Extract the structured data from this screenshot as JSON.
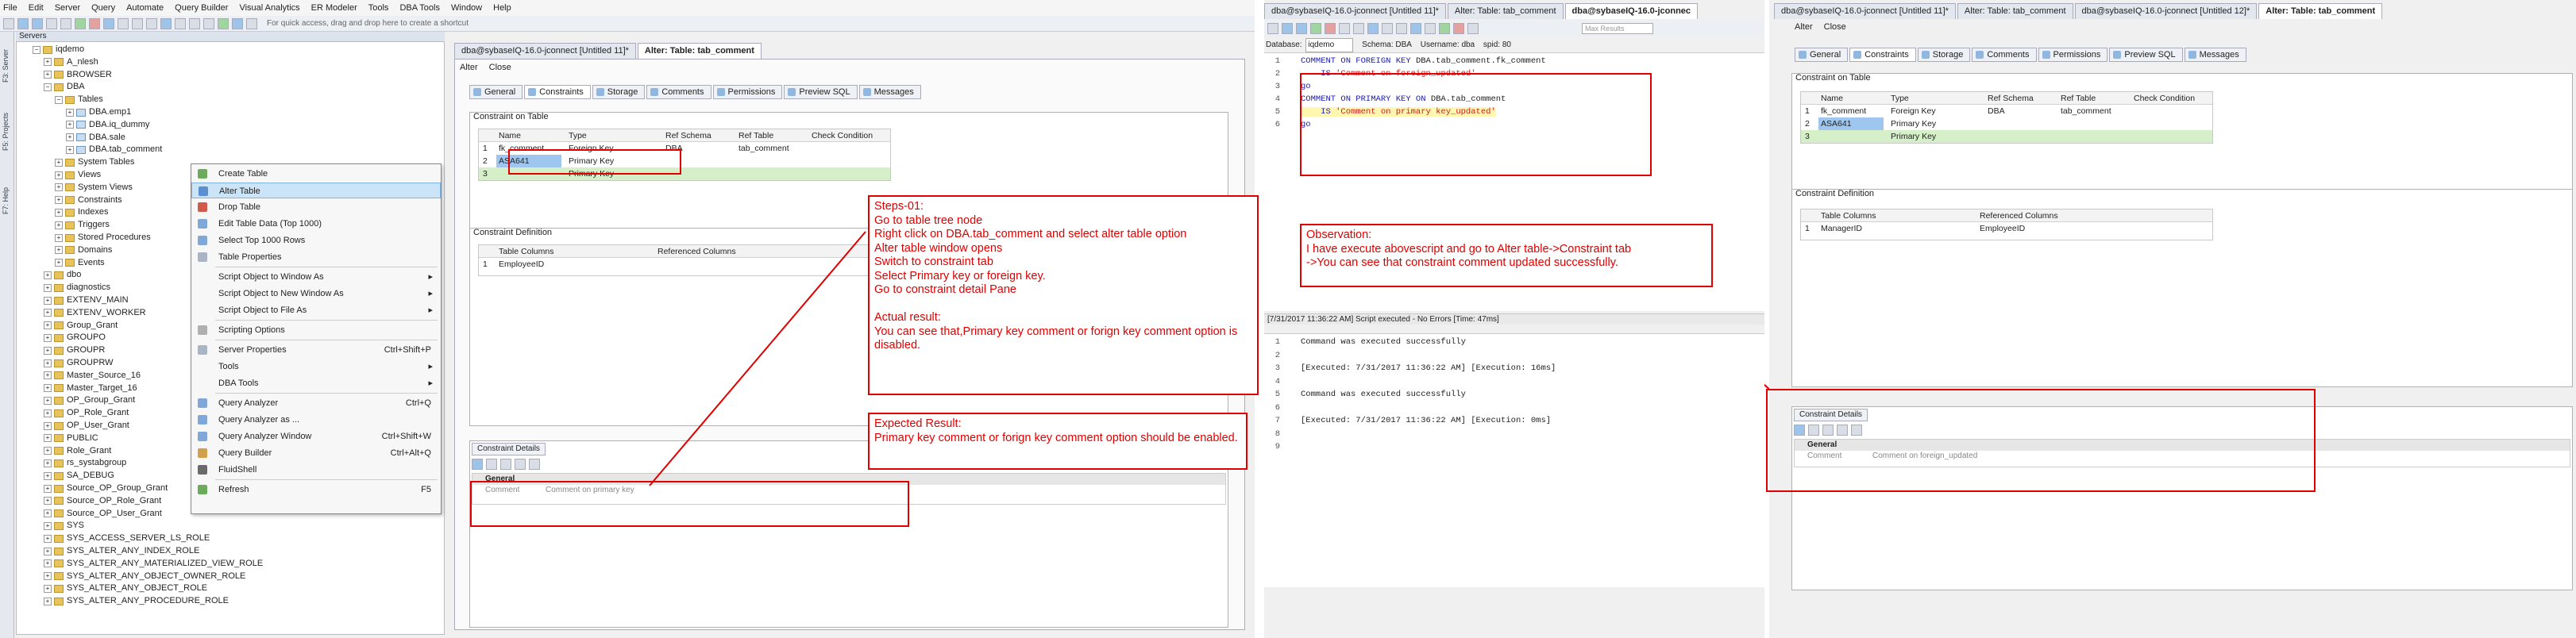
{
  "left_app": {
    "menu": [
      "File",
      "Edit",
      "Server",
      "Query",
      "Automate",
      "Query Builder",
      "Visual Analytics",
      "ER Modeler",
      "Tools",
      "DBA Tools",
      "Window",
      "Help"
    ],
    "quick_access_placeholder": "For quick access, drag and drop here to create a shortcut",
    "servers_label": "Servers",
    "sidebar_tabs": [
      "F3: Server",
      "F5: Projects",
      "F7: Help"
    ],
    "tree": [
      {
        "indent": 1,
        "label": "iqdemo",
        "kind": "folder",
        "exp": "−"
      },
      {
        "indent": 2,
        "label": "A_nlesh",
        "kind": "folder",
        "exp": "+"
      },
      {
        "indent": 2,
        "label": "BROWSER",
        "kind": "folder",
        "exp": "+"
      },
      {
        "indent": 2,
        "label": "DBA",
        "kind": "folder",
        "exp": "−"
      },
      {
        "indent": 3,
        "label": "Tables",
        "kind": "folder",
        "exp": "−"
      },
      {
        "indent": 4,
        "label": "DBA.emp1",
        "kind": "table",
        "exp": "+"
      },
      {
        "indent": 4,
        "label": "DBA.iq_dummy",
        "kind": "table",
        "exp": "+"
      },
      {
        "indent": 4,
        "label": "DBA.sale",
        "kind": "table",
        "exp": "+"
      },
      {
        "indent": 4,
        "label": "DBA.tab_comment",
        "kind": "table",
        "exp": "+"
      },
      {
        "indent": 3,
        "label": "System Tables",
        "kind": "folder",
        "exp": "+"
      },
      {
        "indent": 3,
        "label": "Views",
        "kind": "folder",
        "exp": "+"
      },
      {
        "indent": 3,
        "label": "System Views",
        "kind": "folder",
        "exp": "+"
      },
      {
        "indent": 3,
        "label": "Constraints",
        "kind": "folder",
        "exp": "+"
      },
      {
        "indent": 3,
        "label": "Indexes",
        "kind": "folder",
        "exp": "+"
      },
      {
        "indent": 3,
        "label": "Triggers",
        "kind": "folder",
        "exp": "+"
      },
      {
        "indent": 3,
        "label": "Stored Procedures",
        "kind": "folder",
        "exp": "+"
      },
      {
        "indent": 3,
        "label": "Domains",
        "kind": "folder",
        "exp": "+"
      },
      {
        "indent": 3,
        "label": "Events",
        "kind": "folder",
        "exp": "+"
      },
      {
        "indent": 2,
        "label": "dbo",
        "kind": "folder",
        "exp": "+"
      },
      {
        "indent": 2,
        "label": "diagnostics",
        "kind": "folder",
        "exp": "+"
      },
      {
        "indent": 2,
        "label": "EXTENV_MAIN",
        "kind": "folder",
        "exp": "+"
      },
      {
        "indent": 2,
        "label": "EXTENV_WORKER",
        "kind": "folder",
        "exp": "+"
      },
      {
        "indent": 2,
        "label": "Group_Grant",
        "kind": "folder",
        "exp": "+"
      },
      {
        "indent": 2,
        "label": "GROUPO",
        "kind": "folder",
        "exp": "+"
      },
      {
        "indent": 2,
        "label": "GROUPR",
        "kind": "folder",
        "exp": "+"
      },
      {
        "indent": 2,
        "label": "GROUPRW",
        "kind": "folder",
        "exp": "+"
      },
      {
        "indent": 2,
        "label": "Master_Source_16",
        "kind": "folder",
        "exp": "+"
      },
      {
        "indent": 2,
        "label": "Master_Target_16",
        "kind": "folder",
        "exp": "+"
      },
      {
        "indent": 2,
        "label": "OP_Group_Grant",
        "kind": "folder",
        "exp": "+"
      },
      {
        "indent": 2,
        "label": "OP_Role_Grant",
        "kind": "folder",
        "exp": "+"
      },
      {
        "indent": 2,
        "label": "OP_User_Grant",
        "kind": "folder",
        "exp": "+"
      },
      {
        "indent": 2,
        "label": "PUBLIC",
        "kind": "folder",
        "exp": "+"
      },
      {
        "indent": 2,
        "label": "Role_Grant",
        "kind": "folder",
        "exp": "+"
      },
      {
        "indent": 2,
        "label": "rs_systabgroup",
        "kind": "folder",
        "exp": "+"
      },
      {
        "indent": 2,
        "label": "SA_DEBUG",
        "kind": "folder",
        "exp": "+"
      },
      {
        "indent": 2,
        "label": "Source_OP_Group_Grant",
        "kind": "folder",
        "exp": "+"
      },
      {
        "indent": 2,
        "label": "Source_OP_Role_Grant",
        "kind": "folder",
        "exp": "+"
      },
      {
        "indent": 2,
        "label": "Source_OP_User_Grant",
        "kind": "folder",
        "exp": "+"
      },
      {
        "indent": 2,
        "label": "SYS",
        "kind": "folder",
        "exp": "+"
      },
      {
        "indent": 2,
        "label": "SYS_ACCESS_SERVER_LS_ROLE",
        "kind": "folder",
        "exp": "+"
      },
      {
        "indent": 2,
        "label": "SYS_ALTER_ANY_INDEX_ROLE",
        "kind": "folder",
        "exp": "+"
      },
      {
        "indent": 2,
        "label": "SYS_ALTER_ANY_MATERIALIZED_VIEW_ROLE",
        "kind": "folder",
        "exp": "+"
      },
      {
        "indent": 2,
        "label": "SYS_ALTER_ANY_OBJECT_OWNER_ROLE",
        "kind": "folder",
        "exp": "+"
      },
      {
        "indent": 2,
        "label": "SYS_ALTER_ANY_OBJECT_ROLE",
        "kind": "folder",
        "exp": "+"
      },
      {
        "indent": 2,
        "label": "SYS_ALTER_ANY_PROCEDURE_ROLE",
        "kind": "folder",
        "exp": "+"
      }
    ],
    "context_menu": [
      {
        "label": "Create Table",
        "shortcut": "",
        "arrow": false,
        "sel": false,
        "icon": "#6cab5c"
      },
      {
        "label": "Alter Table",
        "shortcut": "",
        "arrow": false,
        "sel": true,
        "icon": "#5b8fcf"
      },
      {
        "label": "Drop Table",
        "shortcut": "",
        "arrow": false,
        "sel": false,
        "icon": "#d25a4a"
      },
      {
        "label": "Edit Table Data (Top 1000)",
        "shortcut": "",
        "arrow": false,
        "sel": false,
        "icon": "#7fa8d8"
      },
      {
        "label": "Select Top 1000 Rows",
        "shortcut": "",
        "arrow": false,
        "sel": false,
        "icon": "#7fa8d8"
      },
      {
        "label": "Table Properties",
        "shortcut": "",
        "arrow": false,
        "sel": false,
        "icon": "#a9b4c4"
      },
      {
        "label": "Script Object to Window As",
        "shortcut": "",
        "arrow": true,
        "sel": false,
        "icon": ""
      },
      {
        "label": "Script Object to New Window As",
        "shortcut": "",
        "arrow": true,
        "sel": false,
        "icon": ""
      },
      {
        "label": "Script Object to File As",
        "shortcut": "",
        "arrow": true,
        "sel": false,
        "icon": ""
      },
      {
        "label": "Scripting Options",
        "shortcut": "",
        "arrow": false,
        "sel": false,
        "icon": "#b0b0b0"
      },
      {
        "label": "Server Properties",
        "shortcut": "Ctrl+Shift+P",
        "arrow": false,
        "sel": false,
        "icon": "#a9b4c4"
      },
      {
        "label": "Tools",
        "shortcut": "",
        "arrow": true,
        "sel": false,
        "icon": ""
      },
      {
        "label": "DBA Tools",
        "shortcut": "",
        "arrow": true,
        "sel": false,
        "icon": ""
      },
      {
        "label": "Query Analyzer",
        "shortcut": "Ctrl+Q",
        "arrow": false,
        "sel": false,
        "icon": "#7fa8d8"
      },
      {
        "label": "Query Analyzer as ...",
        "shortcut": "",
        "arrow": false,
        "sel": false,
        "icon": "#7fa8d8"
      },
      {
        "label": "Query Analyzer Window",
        "shortcut": "Ctrl+Shift+W",
        "arrow": false,
        "sel": false,
        "icon": "#7fa8d8"
      },
      {
        "label": "Query Builder",
        "shortcut": "Ctrl+Alt+Q",
        "arrow": false,
        "sel": false,
        "icon": "#d2a04a"
      },
      {
        "label": "FluidShell",
        "shortcut": "",
        "arrow": false,
        "sel": false,
        "icon": "#6a6a6a"
      },
      {
        "label": "Refresh",
        "shortcut": "F5",
        "arrow": false,
        "sel": false,
        "icon": "#6cab5c"
      }
    ],
    "editor_tabs": [
      {
        "label": "dba@sybaseIQ-16.0-jconnect [Untitled 11]*",
        "active": false
      },
      {
        "label": "Alter: Table: tab_comment",
        "active": true
      }
    ],
    "alter_buttons": [
      "Alter",
      "Close"
    ],
    "sub_tabs": [
      "General",
      "Constraints",
      "Storage",
      "Comments",
      "Permissions",
      "Preview SQL",
      "Messages"
    ],
    "constraint_group": "Constraint on Table",
    "constraint_headers": [
      "Name",
      "Type",
      "Ref Schema",
      "Ref Table",
      "Check Condition"
    ],
    "constraint_rows": [
      {
        "n": "1",
        "name": "fk_comment",
        "type": "Foreign Key",
        "schema": "DBA",
        "table": "tab_comment",
        "check": ""
      },
      {
        "n": "2",
        "name": "ASA641",
        "type": "Primary Key",
        "schema": "",
        "table": "",
        "check": ""
      },
      {
        "n": "3",
        "name": "",
        "type": "Primary Key",
        "schema": "",
        "table": "",
        "check": ""
      }
    ],
    "definition_group": "Constraint Definition",
    "definition_headers": [
      "Table Columns",
      "Referenced Columns"
    ],
    "definition_rows": [
      {
        "n": "1",
        "col": "EmployeeID",
        "ref": ""
      }
    ],
    "details_label": "Constraint Details",
    "details_section": "General",
    "details_key": "Comment",
    "details_value": "Comment on primary key"
  },
  "notes": {
    "steps": "Steps-01:\nGo to table tree node\nRight click on DBA.tab_comment  and select alter table option\nAlter table window opens\nSwitch to constraint tab\nSelect Primary key or foreign key.\nGo to constraint detail Pane\n\nActual result:\nYou can see that,Primary key comment or forign key comment option is disabled.",
    "expected": "Expected Result:\nPrimary key comment or forign key comment option should be enabled.",
    "observation": "Observation:\nI have execute abovescript and go to Alter table->Constraint tab\n->You can see that constraint comment updated successfully."
  },
  "middle_app": {
    "tabs": [
      {
        "label": "dba@sybaseIQ-16.0-jconnect [Untitled 11]*",
        "active": false
      },
      {
        "label": "Alter: Table: tab_comment",
        "active": false
      },
      {
        "label": "dba@sybaseIQ-16.0-jconnec",
        "active": true
      }
    ],
    "database_label": "Database:",
    "database_value": "iqdemo",
    "schema_label": "Schema:",
    "schema_value": "DBA",
    "username_label": "Username:",
    "username_value": "dba",
    "spid_label": "spid:",
    "spid_value": "80",
    "max_results_placeholder": "Max Results",
    "code": [
      {
        "n": "1",
        "parts": [
          {
            "t": "COMMENT ON FOREIGN KEY ",
            "c": "kw"
          },
          {
            "t": "DBA.tab_comment.fk_comment",
            "c": ""
          }
        ]
      },
      {
        "n": "2",
        "parts": [
          {
            "t": "    IS ",
            "c": "kw"
          },
          {
            "t": "'Comment on foreign_updated'",
            "c": "str"
          }
        ]
      },
      {
        "n": "3",
        "parts": [
          {
            "t": "go",
            "c": "kw"
          }
        ]
      },
      {
        "n": "4",
        "parts": [
          {
            "t": "COMMENT ON PRIMARY KEY ON ",
            "c": "kw"
          },
          {
            "t": "DBA.tab_comment",
            "c": ""
          }
        ]
      },
      {
        "n": "5",
        "parts": [
          {
            "t": "    IS ",
            "c": "kw"
          },
          {
            "t": "'Comment on primary key_updated'",
            "c": "str"
          }
        ]
      },
      {
        "n": "6",
        "parts": [
          {
            "t": "go",
            "c": "kw"
          }
        ]
      }
    ],
    "status": "[7/31/2017 11:36:22 AM] Script executed - No Errors [Time: 47ms]",
    "output": [
      {
        "n": "1",
        "t": "Command was executed successfully"
      },
      {
        "n": "2",
        "t": ""
      },
      {
        "n": "3",
        "t": "[Executed: 7/31/2017 11:36:22 AM] [Execution: 16ms]"
      },
      {
        "n": "4",
        "t": ""
      },
      {
        "n": "5",
        "t": "Command was executed successfully"
      },
      {
        "n": "6",
        "t": ""
      },
      {
        "n": "7",
        "t": "[Executed: 7/31/2017 11:36:22 AM] [Execution: 0ms]"
      },
      {
        "n": "8",
        "t": ""
      },
      {
        "n": "9",
        "t": ""
      }
    ]
  },
  "right_app": {
    "tabs": [
      {
        "label": "dba@sybaseIQ-16.0-jconnect [Untitled 11]*",
        "active": false
      },
      {
        "label": "Alter: Table: tab_comment",
        "active": false
      },
      {
        "label": "dba@sybaseIQ-16.0-jconnect [Untitled 12]*",
        "active": false
      },
      {
        "label": "Alter: Table: tab_comment",
        "active": true
      }
    ],
    "alter_buttons": [
      "Alter",
      "Close"
    ],
    "sub_tabs": [
      "General",
      "Constraints",
      "Storage",
      "Comments",
      "Permissions",
      "Preview SQL",
      "Messages"
    ],
    "constraint_group": "Constraint on Table",
    "constraint_headers": [
      "Name",
      "Type",
      "Ref Schema",
      "Ref Table",
      "Check Condition"
    ],
    "constraint_rows": [
      {
        "n": "1",
        "name": "fk_comment",
        "type": "Foreign Key",
        "schema": "DBA",
        "table": "tab_comment",
        "check": ""
      },
      {
        "n": "2",
        "name": "ASA641",
        "type": "Primary Key",
        "schema": "",
        "table": "",
        "check": ""
      },
      {
        "n": "3",
        "name": "",
        "type": "Primary Key",
        "schema": "",
        "table": "",
        "check": ""
      }
    ],
    "definition_group": "Constraint Definition",
    "definition_headers": [
      "Table Columns",
      "Referenced Columns"
    ],
    "definition_rows": [
      {
        "n": "1",
        "col": "ManagerID",
        "ref": "EmployeeID"
      }
    ],
    "details_label": "Constraint Details",
    "details_section": "General",
    "details_key": "Comment",
    "details_value": "Comment on foreign_updated"
  }
}
